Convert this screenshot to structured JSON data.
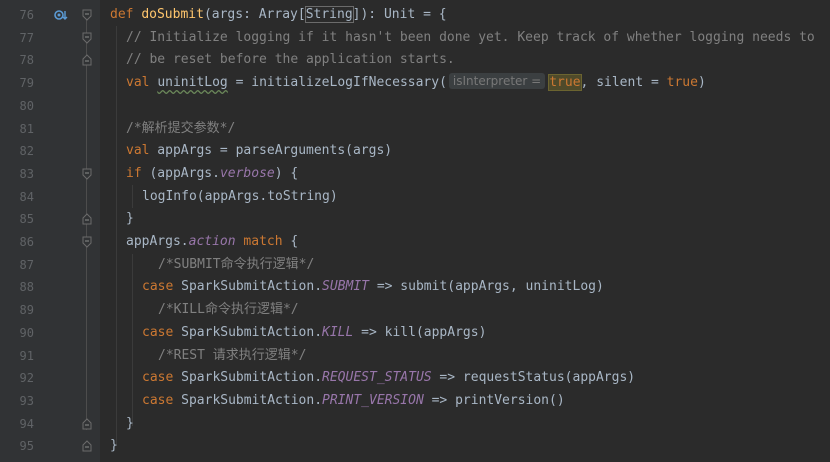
{
  "line_numbers": [
    "76",
    "77",
    "78",
    "79",
    "80",
    "81",
    "82",
    "83",
    "84",
    "85",
    "86",
    "87",
    "88",
    "89",
    "90",
    "91",
    "92",
    "93",
    "94",
    "95"
  ],
  "code": {
    "l76": {
      "def": "def",
      "name": "doSubmit",
      "open": "(args: Array[",
      "type_string": "String",
      "close": "]): ",
      "unit": "Unit",
      "eq": " = {"
    },
    "l77": "// Initialize logging if it hasn't been done yet. Keep track of whether logging needs to",
    "l78": "// be reset before the application starts.",
    "l79": {
      "val": "val",
      "var": "uninitLog",
      "mid": " = initializeLogIfNecessary(",
      "hint": "isInterpreter =",
      "arg_true": "true",
      "rest": ", silent = ",
      "true2": "true",
      "end": ")"
    },
    "l80": "",
    "l81": "/*解析提交参数*/",
    "l82": {
      "val": "val",
      "rest": " appArgs = parseArguments(args)"
    },
    "l83": {
      "if": "if",
      "pre": " (appArgs.",
      "prop": "verbose",
      "post": ") {"
    },
    "l84": "logInfo(appArgs.toString)",
    "l85": "}",
    "l86": {
      "pre": "appArgs.",
      "prop": "action",
      "sp": " ",
      "match": "match",
      "post": " {"
    },
    "l87": "/*SUBMIT命令执行逻辑*/",
    "l88": {
      "case": "case",
      "pre": " SparkSubmitAction.",
      "prop": "SUBMIT",
      "post": " => submit(appArgs, uninitLog)"
    },
    "l89": "/*KILL命令执行逻辑*/",
    "l90": {
      "case": "case",
      "pre": " SparkSubmitAction.",
      "prop": "KILL",
      "post": " => kill(appArgs)"
    },
    "l91": "/*REST 请求执行逻辑*/",
    "l92": {
      "case": "case",
      "pre": " SparkSubmitAction.",
      "prop": "REQUEST_STATUS",
      "post": " => requestStatus(appArgs)"
    },
    "l93": {
      "case": "case",
      "pre": " SparkSubmitAction.",
      "prop": "PRINT_VERSION",
      "post": " => printVersion()"
    },
    "l94": "}",
    "l95": "}"
  },
  "icons": {
    "implements_marker": "override-gutter-icon",
    "fold_marker": "fold-icon"
  },
  "colors": {
    "background": "#2b2b2b",
    "gutter": "#313335",
    "keyword": "#cc7832",
    "function": "#ffc66d",
    "comment": "#808080",
    "property": "#9876aa",
    "text": "#a9b7c6",
    "line_number": "#606366"
  }
}
